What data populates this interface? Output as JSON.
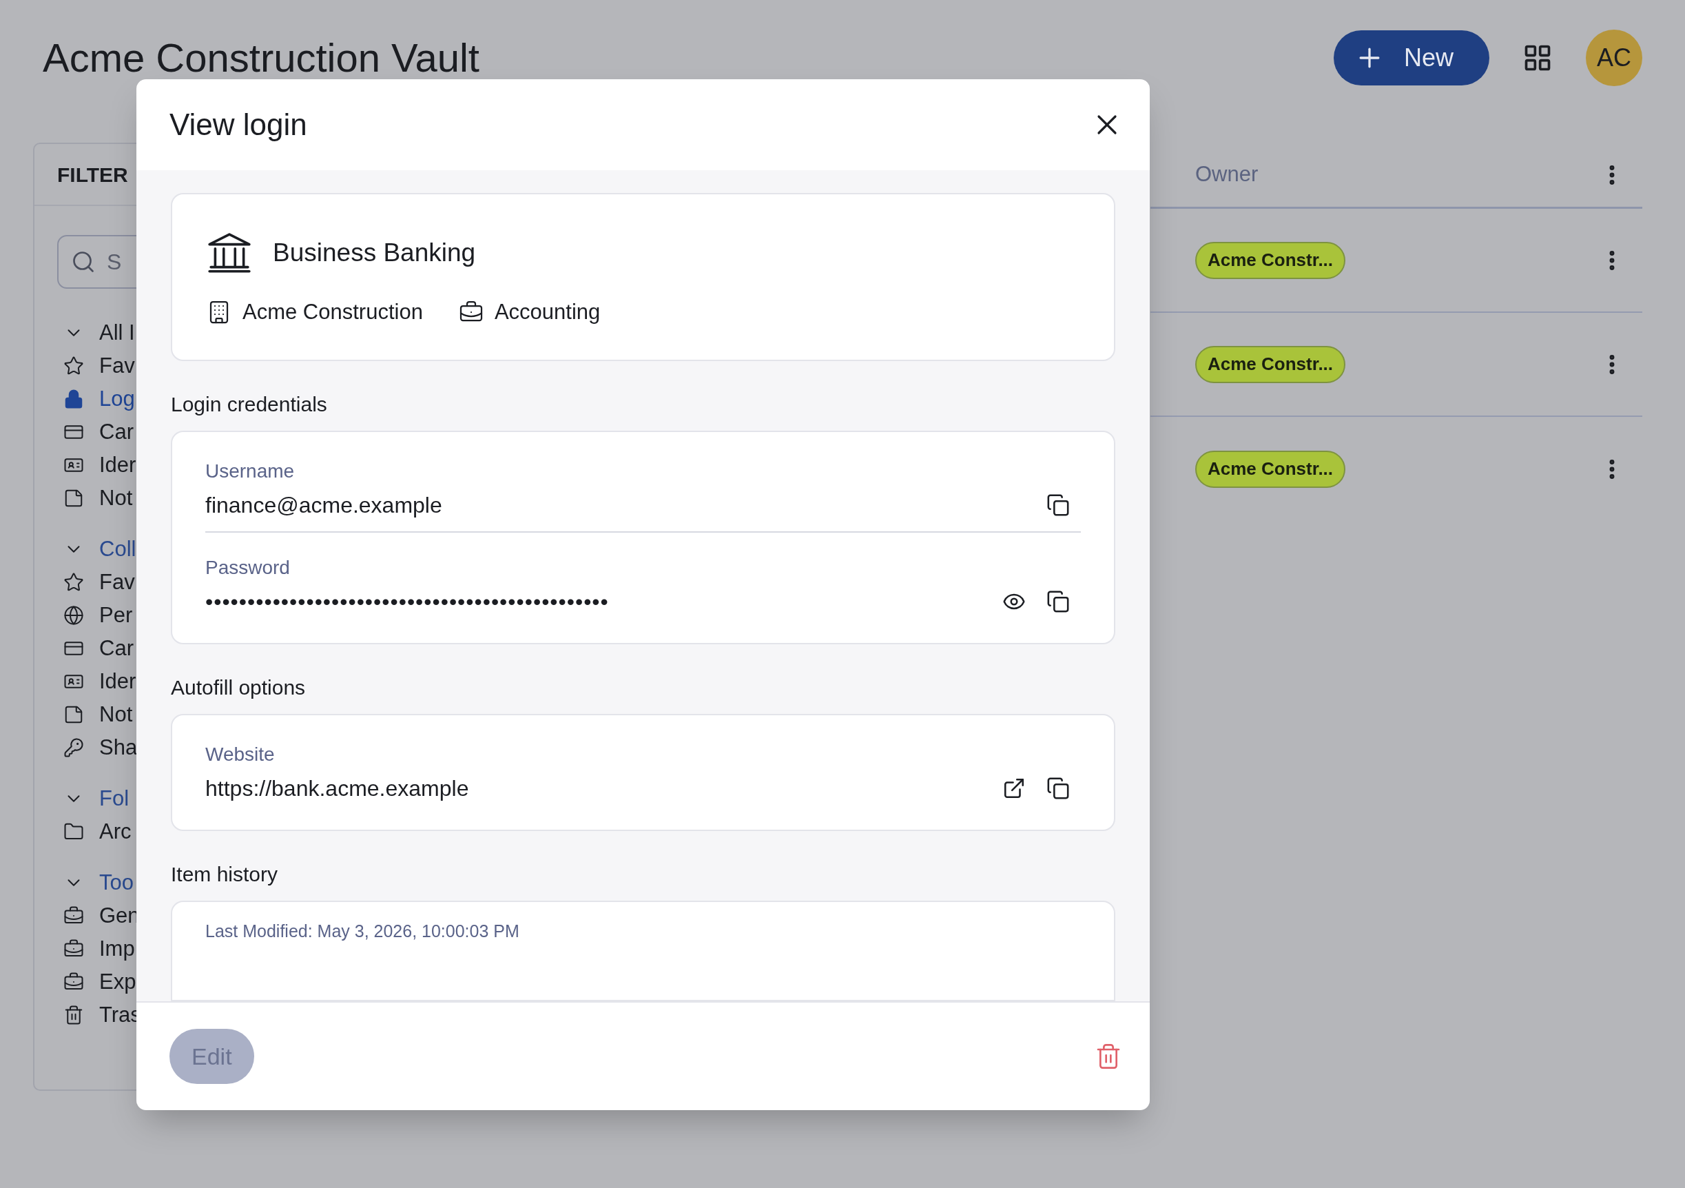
{
  "page": {
    "title": "Acme Construction Vault"
  },
  "toolbar": {
    "new_button": "New",
    "avatar": "AC"
  },
  "filters": {
    "title": "FILTER",
    "search": {
      "placeholder": "S"
    },
    "groups": [
      {
        "label": "All I",
        "kind": "root",
        "expanded": true,
        "items": [
          {
            "label": "Fav",
            "kind": "favorites",
            "selected": false
          },
          {
            "label": "Log",
            "kind": "login",
            "selected": true
          },
          {
            "label": "Car",
            "kind": "card",
            "selected": false
          },
          {
            "label": "Ider",
            "kind": "identity",
            "selected": false
          },
          {
            "label": "Not",
            "kind": "note",
            "selected": false
          }
        ]
      },
      {
        "label": "Coll",
        "kind": "section",
        "expanded": true,
        "items": [
          {
            "label": "Fav",
            "kind": "favorites",
            "selected": false
          },
          {
            "label": "Per",
            "kind": "globe",
            "selected": false
          },
          {
            "label": "Car",
            "kind": "card",
            "selected": false
          },
          {
            "label": "Ider",
            "kind": "identity",
            "selected": false
          },
          {
            "label": "Not",
            "kind": "note",
            "selected": false
          },
          {
            "label": "Sha",
            "kind": "key",
            "selected": false
          }
        ]
      },
      {
        "label": "Fol",
        "kind": "section",
        "expanded": true,
        "items": [
          {
            "label": "Arc",
            "kind": "folder",
            "selected": false
          }
        ]
      },
      {
        "label": "Too",
        "kind": "section",
        "expanded": true,
        "items": [
          {
            "label": "Gen",
            "kind": "tool",
            "selected": false
          },
          {
            "label": "Imp",
            "kind": "tool",
            "selected": false
          },
          {
            "label": "Exp",
            "kind": "tool",
            "selected": false
          },
          {
            "label": "Tras",
            "kind": "trash",
            "selected": false
          }
        ]
      }
    ]
  },
  "table": {
    "columns": [
      "Owner"
    ],
    "rows": [
      {
        "owner": "Acme Constr..."
      },
      {
        "owner": "Acme Constr..."
      },
      {
        "owner": "Acme Constr..."
      }
    ]
  },
  "dialog": {
    "title": "View login",
    "item": {
      "name": "Business Banking",
      "organization": "Acme Construction",
      "collection": "Accounting"
    },
    "sections": [
      {
        "title": "Login credentials",
        "fields": [
          {
            "label": "Username",
            "value": "finance@acme.example",
            "kind": "text"
          },
          {
            "label": "Password",
            "value": "••••••••••••••••••••••••••••••••••••••••••••••••",
            "kind": "password"
          }
        ]
      },
      {
        "title": "Autofill options",
        "fields": [
          {
            "label": "Website",
            "value": "https://bank.acme.example",
            "kind": "link"
          }
        ]
      }
    ],
    "history": {
      "title": "Item history",
      "last_modified": "Last Modified: May 3, 2026, 10:00:03 PM"
    },
    "edit_button": {
      "label": "Edit",
      "disabled": true
    }
  }
}
